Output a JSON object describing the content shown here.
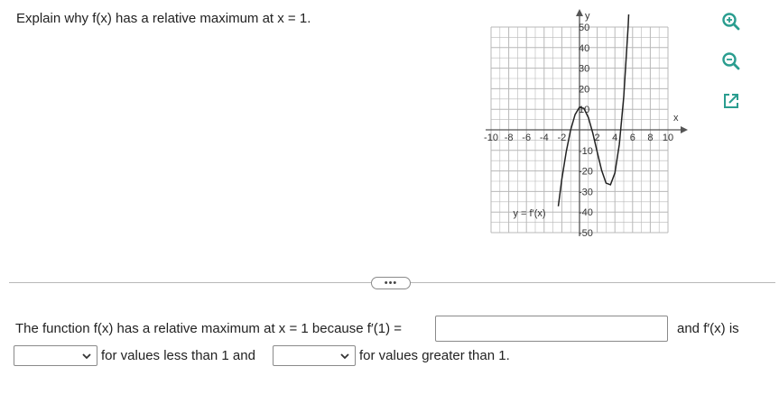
{
  "question": {
    "text": "Explain why f(x) has a relative maximum at x = 1."
  },
  "graph": {
    "curve_label": "y = f'(x)",
    "axis_labels": {
      "x": "x",
      "y": "y"
    },
    "x_ticks": [
      "-10",
      "-8",
      "-6",
      "-4",
      "-2",
      "2",
      "4",
      "6",
      "8",
      "10"
    ],
    "y_ticks": [
      "50",
      "40",
      "30",
      "20",
      "10",
      "-10",
      "-20",
      "-30",
      "-40",
      "-50"
    ]
  },
  "chart_data": {
    "type": "line",
    "title": "",
    "xlabel": "x",
    "ylabel": "y",
    "xlim": [
      -10,
      10
    ],
    "ylim": [
      -50,
      50
    ],
    "grid": true,
    "series": [
      {
        "name": "y = f'(x)",
        "x": [
          -2.4,
          -2,
          -1.5,
          -1,
          -0.5,
          0,
          0.5,
          1,
          1.5,
          2,
          2.5,
          3,
          3.5,
          4,
          4.5,
          5,
          5.5,
          6,
          6.5
        ],
        "y": [
          -37.2,
          -24.0,
          -10.6,
          0.0,
          7.4,
          11.0,
          10.4,
          6.0,
          -1.6,
          -10.8,
          -19.7,
          -25.9,
          -26.7,
          -21.0,
          -7.1,
          16.0,
          50.5,
          97.0,
          158.0
        ]
      }
    ]
  },
  "toolbar": {
    "zoom_in_icon": "zoom-in-icon",
    "zoom_out_icon": "zoom-out-icon",
    "popout_icon": "external-window-icon"
  },
  "more_button_label": "•••",
  "answer": {
    "line1_text": "The function f(x) has a relative maximum at x = 1 because f′(1) =",
    "input_value": "",
    "line1_suffix": "and f′(x) is",
    "select1_value": "",
    "line2_mid": "for values less than 1 and",
    "select2_value": "",
    "line2_end": "for values greater than 1."
  },
  "colors": {
    "grid": "#b8b8b8",
    "axis": "#555555",
    "curve": "#222222",
    "accent": "#2a9d8f"
  }
}
